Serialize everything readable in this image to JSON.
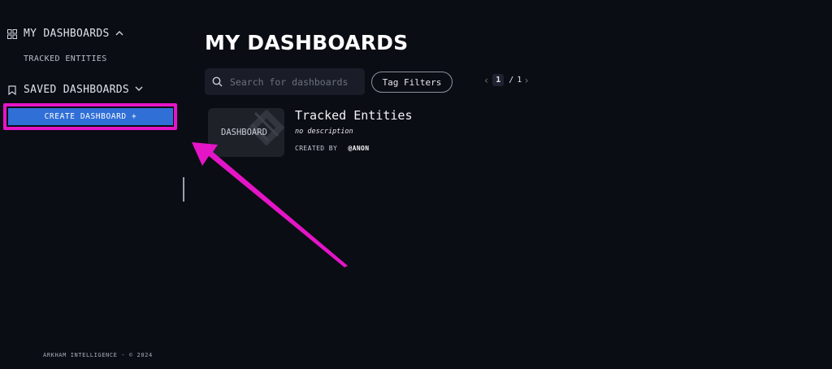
{
  "sidebar": {
    "my_dashboards_label": "MY DASHBOARDS",
    "tracked_entities_label": "TRACKED ENTITIES",
    "saved_dashboards_label": "SAVED DASHBOARDS",
    "create_button_label": "CREATE DASHBOARD +",
    "footer": "ARKHAM INTELLIGENCE - © 2024"
  },
  "main": {
    "title": "MY DASHBOARDS",
    "search_placeholder": "Search for dashboards",
    "tag_filters_label": "Tag Filters",
    "pager": {
      "current": "1",
      "separator": "/",
      "total": "1"
    }
  },
  "cards": [
    {
      "thumb_label": "DASHBOARD",
      "title": "Tracked Entities",
      "description": "no description",
      "created_by_label": "CREATED BY",
      "author": "@ANON"
    }
  ],
  "colors": {
    "background": "#0b0d14",
    "accent_blue": "#2f6fd6",
    "highlight_magenta": "#e515c7"
  },
  "icons": {
    "my_dashboards": "grid-icon",
    "saved_dashboards": "bookmark-icon",
    "search": "search-icon"
  }
}
